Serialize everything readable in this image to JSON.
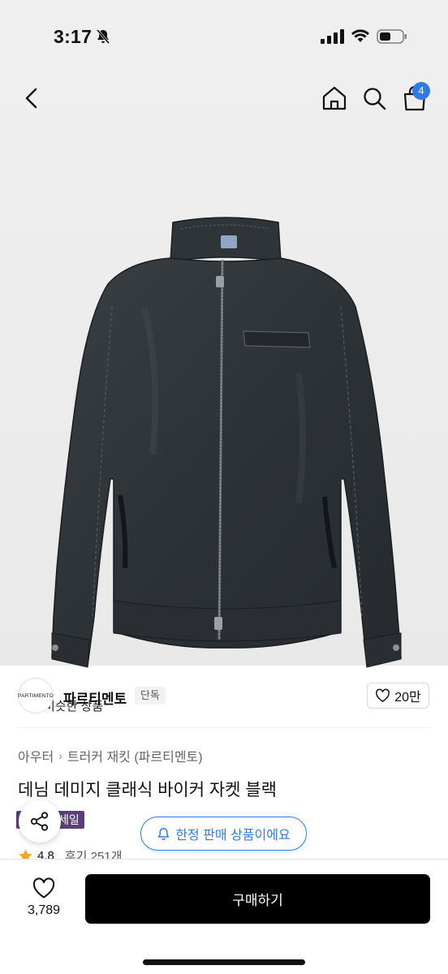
{
  "status_bar": {
    "time": "3:17"
  },
  "nav": {
    "cart_count": "4"
  },
  "similar": {
    "label": "비슷한 상품"
  },
  "brand": {
    "logo_text": "PARTIMENTO",
    "name": "파르티멘토",
    "tag": "단독",
    "likes": "20만"
  },
  "breadcrumb": {
    "category": "아우터",
    "subcategory": "트러커 재킷 (파르티멘토)"
  },
  "product": {
    "title": "데님 데미지 클래식 바이커 자켓 블랙",
    "sale_badge": "세일",
    "rating": "4.8",
    "reviews": "후기 251개"
  },
  "limited_notice": "한정 판매 상품이에요",
  "bottom": {
    "wish_count": "3,789",
    "buy_label": "구매하기"
  },
  "colors": {
    "accent": "#2f7be6",
    "sale": "#5b3f78",
    "buy_button": "#000000",
    "star": "#f5a623"
  }
}
